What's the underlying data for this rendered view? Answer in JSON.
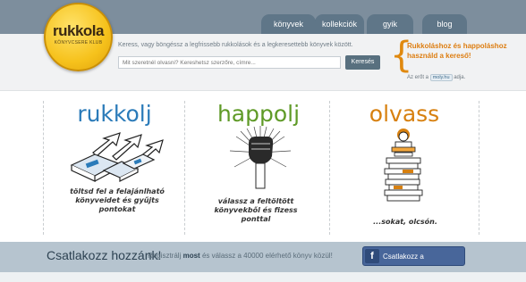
{
  "logo": {
    "name": "rukkola",
    "subtitle": "KÖNYVCSERE KLUB"
  },
  "nav": [
    {
      "label": "könyvek"
    },
    {
      "label": "kollekciók"
    },
    {
      "label": "gyik"
    },
    {
      "label": "blog"
    }
  ],
  "search": {
    "tagline": "Keress, vagy böngéssz a legfrissebb rukkolások és a legkeresettebb könyvek között.",
    "placeholder": "Mit szeretnél olvasni? Kereshetsz szerzőre, címre...",
    "button": "Keresés"
  },
  "side": {
    "message": "Rukkoláshoz és happoláshoz használd a kereső!",
    "note_prefix": "Az erőt a",
    "badge": "moly.hu",
    "note_suffix": "adja."
  },
  "columns": [
    {
      "title": "rukkolj",
      "color": "#2b7bb9",
      "caption": "töltsd fel a felajánlható könyveidet és gyűjts pontokat"
    },
    {
      "title": "happolj",
      "color": "#5f9a27",
      "caption": "válassz a feltöltött könyvekből és fizess ponttal"
    },
    {
      "title": "olvass",
      "color": "#d7800f",
      "caption": "...sokat, olcsón."
    }
  ],
  "footer": {
    "join_title": "Csatlakozz hozzánk!",
    "join_text_a": "Regisztrálj",
    "join_text_b": "most",
    "join_text_c": "és válassz a 40000 elérhető könyv közül!",
    "fb_label": "Csatlakozz a Facebookkal"
  }
}
